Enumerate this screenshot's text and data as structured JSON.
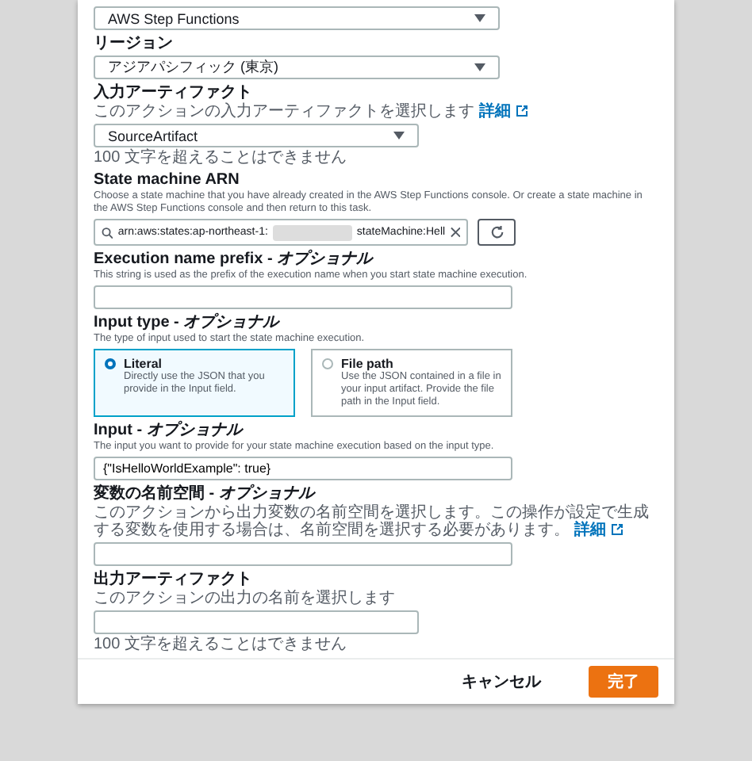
{
  "modal": {
    "fields": [
      {
        "kind": "select",
        "value": "AWS Step Functions"
      },
      {
        "kind": "select",
        "label": "リージョン",
        "value": "アジアパシフィック (東京)"
      },
      {
        "kind": "select",
        "label": "入力アーティファクト",
        "description": "このアクションの入力アーティファクトを選択します",
        "link": "詳細",
        "value": "SourceArtifact",
        "hint": "100 文字を超えることはできません"
      },
      {
        "kind": "search",
        "label": "State machine ARN",
        "description": "Choose a state machine that you have already created in the AWS Step Functions console. Or create a state machine in the AWS Step Functions console and then return to this task.",
        "value_start": "arn:aws:states:ap-northeast-1:",
        "redacted": true,
        "value_end": "stateMachine:Hell"
      },
      {
        "kind": "text",
        "label": "Execution name prefix - *オプショナル*",
        "description": "This string is used as the prefix of the execution name when you start state machine execution."
      },
      {
        "kind": "radio",
        "label": "Input type - *オプショナル*",
        "description": "The type of input used to start the state machine execution.",
        "options": [
          {
            "title": "Literal",
            "text": "Directly use the JSON that you provide in the Input field.",
            "selected": true
          },
          {
            "title": "File path",
            "text": "Use the JSON contained in a file in your input artifact. Provide the file path in the Input field.",
            "selected": false
          }
        ]
      },
      {
        "kind": "text",
        "label": "Input - *オプショナル*",
        "description": "The input you want to provide for your state machine execution based on the input type.",
        "value": "{\"IsHelloWorldExample\": true}"
      },
      {
        "kind": "text",
        "label": "変数の名前空間 - *オプショナル*",
        "description": "このアクションから出力変数の名前空間を選択します。この操作が設定で生成する変数を使用する場合は、名前空間を選択する必要があります。",
        "link": "詳細"
      },
      {
        "kind": "text",
        "label": "出力アーティファクト",
        "description": "このアクションの出力の名前を選択します",
        "hint": "100 文字を超えることはできません"
      }
    ],
    "buttons": [
      {
        "kind": "cancel",
        "label": "キャンセル"
      },
      {
        "kind": "primary",
        "label": "完了"
      }
    ]
  }
}
